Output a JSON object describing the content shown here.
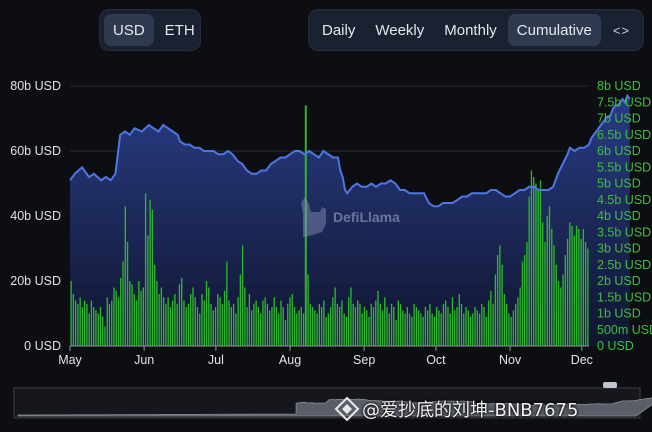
{
  "toggles": {
    "currency": [
      {
        "label": "USD",
        "active": true
      },
      {
        "label": "ETH",
        "active": false
      }
    ],
    "period": [
      {
        "label": "Daily",
        "active": false
      },
      {
        "label": "Weekly",
        "active": false
      },
      {
        "label": "Monthly",
        "active": false
      },
      {
        "label": "Cumulative",
        "active": true
      }
    ],
    "embed_icon": "code-brackets-icon",
    "embed_glyph": "<>"
  },
  "brand": {
    "logo_text": "DefiLlama"
  },
  "watermark": {
    "text": "@爱抄底的刘坤-BNB7675"
  },
  "colors": {
    "line": "#4f77e4",
    "area_top": "#2a3f8a",
    "bar": "#2fb52f",
    "right_axis": "#3fbf3f",
    "left_axis": "#dfe2ea",
    "background": "#0d0e11"
  },
  "chart_data": {
    "type": "bar",
    "grid": true,
    "x_tick_labels": [
      "May",
      "Jun",
      "Jul",
      "Aug",
      "Sep",
      "Oct",
      "Nov",
      "Dec"
    ],
    "left_axis": {
      "ticks": [
        "80b USD",
        "60b USD",
        "40b USD",
        "20b USD",
        "0 USD"
      ],
      "ylim": [
        0,
        80
      ]
    },
    "right_axis": {
      "ticks": [
        "8b USD",
        "7.5b USD",
        "7b USD",
        "6.5b USD",
        "6b USD",
        "5.5b USD",
        "5b USD",
        "4.5b USD",
        "4b USD",
        "3.5b USD",
        "3b USD",
        "2.5b USD",
        "2b USD",
        "1.5b USD",
        "1b USD",
        "500m USD",
        "0 USD"
      ],
      "ylim": [
        0,
        8
      ]
    },
    "x_range": [
      0,
      217
    ],
    "month_starts": [
      0,
      31,
      61,
      92,
      123,
      153,
      184,
      214
    ],
    "line_unit": "b USD (left axis)",
    "bar_unit": "b USD (right axis)",
    "line_points": [
      [
        0,
        51
      ],
      [
        2,
        53
      ],
      [
        5,
        55
      ],
      [
        8,
        52
      ],
      [
        10,
        53
      ],
      [
        13,
        51
      ],
      [
        15,
        52
      ],
      [
        17,
        51
      ],
      [
        19,
        53
      ],
      [
        21,
        65
      ],
      [
        23,
        66
      ],
      [
        25,
        65
      ],
      [
        27,
        67
      ],
      [
        30,
        66
      ],
      [
        33,
        68
      ],
      [
        35,
        67
      ],
      [
        37,
        66
      ],
      [
        39,
        68
      ],
      [
        41,
        67
      ],
      [
        43,
        66
      ],
      [
        45,
        65
      ],
      [
        46,
        63
      ],
      [
        48,
        62
      ],
      [
        50,
        62
      ],
      [
        52,
        61
      ],
      [
        54,
        61
      ],
      [
        56,
        60
      ],
      [
        58,
        60
      ],
      [
        60,
        60
      ],
      [
        62,
        59
      ],
      [
        64,
        59
      ],
      [
        66,
        60
      ],
      [
        68,
        59
      ],
      [
        70,
        57
      ],
      [
        72,
        56
      ],
      [
        74,
        54
      ],
      [
        76,
        53
      ],
      [
        78,
        53
      ],
      [
        80,
        54
      ],
      [
        82,
        54
      ],
      [
        84,
        56
      ],
      [
        86,
        57
      ],
      [
        88,
        58
      ],
      [
        90,
        58
      ],
      [
        92,
        59
      ],
      [
        94,
        60
      ],
      [
        96,
        60
      ],
      [
        98,
        59
      ],
      [
        100,
        60
      ],
      [
        102,
        59
      ],
      [
        104,
        58
      ],
      [
        106,
        60
      ],
      [
        108,
        59
      ],
      [
        110,
        58
      ],
      [
        112,
        58
      ],
      [
        113,
        54
      ],
      [
        114,
        52
      ],
      [
        115,
        48
      ],
      [
        116,
        47
      ],
      [
        118,
        49
      ],
      [
        120,
        50
      ],
      [
        122,
        49
      ],
      [
        124,
        49
      ],
      [
        126,
        50
      ],
      [
        128,
        49
      ],
      [
        130,
        50
      ],
      [
        132,
        50
      ],
      [
        134,
        51
      ],
      [
        136,
        50
      ],
      [
        138,
        48
      ],
      [
        140,
        48
      ],
      [
        142,
        47
      ],
      [
        144,
        47
      ],
      [
        146,
        47
      ],
      [
        148,
        47
      ],
      [
        150,
        44
      ],
      [
        152,
        43
      ],
      [
        154,
        43
      ],
      [
        156,
        44
      ],
      [
        158,
        44
      ],
      [
        160,
        44
      ],
      [
        162,
        45
      ],
      [
        164,
        46
      ],
      [
        166,
        46
      ],
      [
        168,
        47
      ],
      [
        170,
        47
      ],
      [
        172,
        47
      ],
      [
        174,
        47
      ],
      [
        176,
        48
      ],
      [
        178,
        48
      ],
      [
        180,
        47
      ],
      [
        182,
        46
      ],
      [
        184,
        46
      ],
      [
        186,
        47
      ],
      [
        188,
        48
      ],
      [
        190,
        48
      ],
      [
        192,
        49
      ],
      [
        194,
        49
      ],
      [
        196,
        48
      ],
      [
        198,
        48
      ],
      [
        200,
        48
      ],
      [
        202,
        49
      ],
      [
        204,
        53
      ],
      [
        206,
        56
      ],
      [
        208,
        59
      ],
      [
        209,
        61
      ],
      [
        211,
        60
      ],
      [
        213,
        61
      ],
      [
        215,
        61
      ],
      [
        217,
        62
      ],
      [
        218,
        64
      ],
      [
        220,
        66
      ],
      [
        222,
        68
      ],
      [
        224,
        70
      ],
      [
        226,
        71
      ],
      [
        227,
        73
      ],
      [
        228,
        74
      ],
      [
        229,
        74
      ],
      [
        230,
        75
      ],
      [
        231,
        76
      ],
      [
        232,
        75
      ],
      [
        233,
        77
      ],
      [
        234,
        76
      ]
    ],
    "bars": [
      2.0,
      1.6,
      1.4,
      1.3,
      1.5,
      1.2,
      1.4,
      1.3,
      1.0,
      1.4,
      1.2,
      1.1,
      1.0,
      1.2,
      0.9,
      0.6,
      1.5,
      1.3,
      1.4,
      1.8,
      1.7,
      1.5,
      2.1,
      2.6,
      4.3,
      3.2,
      2.0,
      1.9,
      1.6,
      1.4,
      2.0,
      1.7,
      1.8,
      4.7,
      3.4,
      4.5,
      4.2,
      2.5,
      2.0,
      1.6,
      1.8,
      1.5,
      1.3,
      1.5,
      1.2,
      1.4,
      1.6,
      1.3,
      1.9,
      2.1,
      1.4,
      1.2,
      1.3,
      1.6,
      1.8,
      1.5,
      1.2,
      1.0,
      1.6,
      1.4,
      2.0,
      1.8,
      1.3,
      1.1,
      1.2,
      1.6,
      1.5,
      1.3,
      1.7,
      2.6,
      1.4,
      1.2,
      1.3,
      1.0,
      1.5,
      2.2,
      3.1,
      1.8,
      1.2,
      1.6,
      1.1,
      1.3,
      1.4,
      1.2,
      1.0,
      1.4,
      1.5,
      1.3,
      1.1,
      1.2,
      1.5,
      1.2,
      1.0,
      1.4,
      1.2,
      0.8,
      1.3,
      1.5,
      1.6,
      1.2,
      1.0,
      1.1,
      1.2,
      1.0,
      0.9,
      2.2,
      1.3,
      1.2,
      1.1,
      1.0,
      1.3,
      1.2,
      1.4,
      0.9,
      1.0,
      1.2,
      1.5,
      1.8,
      1.3,
      1.2,
      1.4,
      1.0,
      0.9,
      1.5,
      1.8,
      1.3,
      1.2,
      1.4,
      1.3,
      1.0,
      1.2,
      1.1,
      0.9,
      1.3,
      1.2,
      1.4,
      1.7,
      1.3,
      1.1,
      1.5,
      1.2,
      1.0,
      1.3,
      1.2,
      0.8,
      1.4,
      1.3,
      1.1,
      1.0,
      1.2,
      1.0,
      0.9,
      1.3,
      1.2,
      1.1,
      1.0,
      0.9,
      1.2,
      1.1,
      1.3,
      1.0,
      0.9,
      1.2,
      1.1,
      1.0,
      1.3,
      1.4,
      1.2,
      1.0,
      1.5,
      1.1,
      1.2,
      1.6,
      1.3,
      1.0,
      1.2,
      1.1,
      0.9,
      1.0,
      1.2,
      1.1,
      1.0,
      1.3,
      1.2,
      0.9,
      1.4,
      1.7,
      1.3,
      2.2,
      2.8,
      3.1,
      2.5,
      1.6,
      1.3,
      1.0,
      0.9,
      1.1,
      1.3,
      1.5,
      1.8,
      2.6,
      2.8,
      3.2,
      4.6,
      5.4,
      5.2,
      5.0,
      4.8,
      5.1,
      3.8,
      3.2,
      4.0,
      4.3,
      3.6,
      3.1,
      2.5,
      2.0,
      1.8,
      2.2,
      2.8,
      3.3,
      3.8,
      3.7,
      3.4,
      3.7,
      3.6,
      3.3,
      3.6,
      3.2,
      3.0
    ]
  }
}
